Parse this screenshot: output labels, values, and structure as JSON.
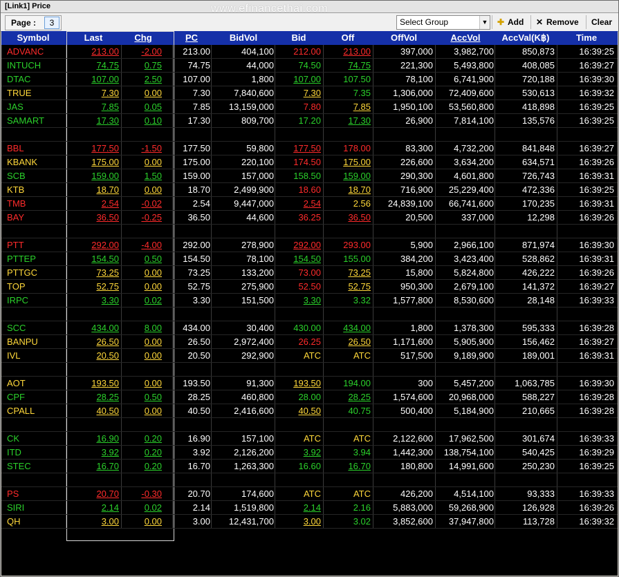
{
  "window": {
    "title": "[Link1] Price",
    "watermark": "www.efinancethai.com"
  },
  "toolbar": {
    "page_label": "Page :",
    "page_value": "3",
    "select_group": {
      "selected": "Select Group"
    },
    "add_label": "Add",
    "remove_label": "Remove",
    "clear_label": "Clear"
  },
  "colors": {
    "up": "#2bd12b",
    "down": "#ff2b2b",
    "unchanged": "#ffd83a",
    "header_bg": "#1530a8",
    "grid_bg": "#000000"
  },
  "columns": [
    "Symbol",
    "Last",
    "Chg",
    "PC",
    "BidVol",
    "Bid",
    "Off",
    "OffVol",
    "AccVol",
    "AccVal(K฿)",
    "Time"
  ],
  "rows": [
    {
      "symbol": "ADVANC",
      "last": "213.00",
      "chg": "-2.00",
      "pc": "213.00",
      "bidvol": "404,100",
      "bid": "212.00",
      "off": "213.00",
      "offvol": "397,000",
      "accvol": "3,982,700",
      "accval": "850,873",
      "time": "16:39:25",
      "c": {
        "sym": "down",
        "last": "down",
        "chg": "down",
        "bid": "down",
        "off": "down"
      }
    },
    {
      "symbol": "INTUCH",
      "last": "74.75",
      "chg": "0.75",
      "pc": "74.75",
      "bidvol": "44,000",
      "bid": "74.50",
      "off": "74.75",
      "offvol": "221,300",
      "accvol": "5,493,800",
      "accval": "408,085",
      "time": "16:39:27",
      "c": {
        "sym": "up",
        "last": "up",
        "chg": "up",
        "bid": "up",
        "off": "up"
      }
    },
    {
      "symbol": "DTAC",
      "last": "107.00",
      "chg": "2.50",
      "pc": "107.00",
      "bidvol": "1,800",
      "bid": "107.00",
      "off": "107.50",
      "offvol": "78,100",
      "accvol": "6,741,900",
      "accval": "720,188",
      "time": "16:39:30",
      "c": {
        "sym": "up",
        "last": "up",
        "chg": "up",
        "bid": "up",
        "off": "up"
      }
    },
    {
      "symbol": "TRUE",
      "last": "7.30",
      "chg": "0.00",
      "pc": "7.30",
      "bidvol": "7,840,600",
      "bid": "7.30",
      "off": "7.35",
      "offvol": "1,306,000",
      "accvol": "72,409,600",
      "accval": "530,613",
      "time": "16:39:32",
      "c": {
        "sym": "unchanged",
        "last": "unchanged",
        "chg": "unchanged",
        "bid": "unchanged",
        "off": "up"
      }
    },
    {
      "symbol": "JAS",
      "last": "7.85",
      "chg": "0.05",
      "pc": "7.85",
      "bidvol": "13,159,000",
      "bid": "7.80",
      "off": "7.85",
      "offvol": "1,950,100",
      "accvol": "53,560,800",
      "accval": "418,898",
      "time": "16:39:25",
      "c": {
        "sym": "up",
        "last": "up",
        "chg": "up",
        "bid": "down",
        "off": "unchanged"
      }
    },
    {
      "symbol": "SAMART",
      "last": "17.30",
      "chg": "0.10",
      "pc": "17.30",
      "bidvol": "809,700",
      "bid": "17.20",
      "off": "17.30",
      "offvol": "26,900",
      "accvol": "7,814,100",
      "accval": "135,576",
      "time": "16:39:25",
      "c": {
        "sym": "up",
        "last": "up",
        "chg": "up",
        "bid": "up",
        "off": "up"
      }
    },
    {
      "blank": true
    },
    {
      "symbol": "BBL",
      "last": "177.50",
      "chg": "-1.50",
      "pc": "177.50",
      "bidvol": "59,800",
      "bid": "177.50",
      "off": "178.00",
      "offvol": "83,300",
      "accvol": "4,732,200",
      "accval": "841,848",
      "time": "16:39:27",
      "c": {
        "sym": "down",
        "last": "down",
        "chg": "down",
        "bid": "down",
        "off": "down"
      }
    },
    {
      "symbol": "KBANK",
      "last": "175.00",
      "chg": "0.00",
      "pc": "175.00",
      "bidvol": "220,100",
      "bid": "174.50",
      "off": "175.00",
      "offvol": "226,600",
      "accvol": "3,634,200",
      "accval": "634,571",
      "time": "16:39:26",
      "c": {
        "sym": "unchanged",
        "last": "unchanged",
        "chg": "unchanged",
        "bid": "down",
        "off": "unchanged"
      }
    },
    {
      "symbol": "SCB",
      "last": "159.00",
      "chg": "1.50",
      "pc": "159.00",
      "bidvol": "157,000",
      "bid": "158.50",
      "off": "159.00",
      "offvol": "290,300",
      "accvol": "4,601,800",
      "accval": "726,743",
      "time": "16:39:31",
      "c": {
        "sym": "up",
        "last": "up",
        "chg": "up",
        "bid": "up",
        "off": "up"
      }
    },
    {
      "symbol": "KTB",
      "last": "18.70",
      "chg": "0.00",
      "pc": "18.70",
      "bidvol": "2,499,900",
      "bid": "18.60",
      "off": "18.70",
      "offvol": "716,900",
      "accvol": "25,229,400",
      "accval": "472,336",
      "time": "16:39:25",
      "c": {
        "sym": "unchanged",
        "last": "unchanged",
        "chg": "unchanged",
        "bid": "down",
        "off": "unchanged"
      }
    },
    {
      "symbol": "TMB",
      "last": "2.54",
      "chg": "-0.02",
      "pc": "2.54",
      "bidvol": "9,447,000",
      "bid": "2.54",
      "off": "2.56",
      "offvol": "24,839,100",
      "accvol": "66,741,600",
      "accval": "170,235",
      "time": "16:39:31",
      "c": {
        "sym": "down",
        "last": "down",
        "chg": "down",
        "bid": "down",
        "off": "unchanged"
      }
    },
    {
      "symbol": "BAY",
      "last": "36.50",
      "chg": "-0.25",
      "pc": "36.50",
      "bidvol": "44,600",
      "bid": "36.25",
      "off": "36.50",
      "offvol": "20,500",
      "accvol": "337,000",
      "accval": "12,298",
      "time": "16:39:26",
      "c": {
        "sym": "down",
        "last": "down",
        "chg": "down",
        "bid": "down",
        "off": "down"
      }
    },
    {
      "blank": true
    },
    {
      "symbol": "PTT",
      "last": "292.00",
      "chg": "-4.00",
      "pc": "292.00",
      "bidvol": "278,900",
      "bid": "292.00",
      "off": "293.00",
      "offvol": "5,900",
      "accvol": "2,966,100",
      "accval": "871,974",
      "time": "16:39:30",
      "c": {
        "sym": "down",
        "last": "down",
        "chg": "down",
        "bid": "down",
        "off": "down"
      }
    },
    {
      "symbol": "PTTEP",
      "last": "154.50",
      "chg": "0.50",
      "pc": "154.50",
      "bidvol": "78,100",
      "bid": "154.50",
      "off": "155.00",
      "offvol": "384,200",
      "accvol": "3,423,400",
      "accval": "528,862",
      "time": "16:39:31",
      "c": {
        "sym": "up",
        "last": "up",
        "chg": "up",
        "bid": "up",
        "off": "up"
      }
    },
    {
      "symbol": "PTTGC",
      "last": "73.25",
      "chg": "0.00",
      "pc": "73.25",
      "bidvol": "133,200",
      "bid": "73.00",
      "off": "73.25",
      "offvol": "15,800",
      "accvol": "5,824,800",
      "accval": "426,222",
      "time": "16:39:26",
      "c": {
        "sym": "unchanged",
        "last": "unchanged",
        "chg": "unchanged",
        "bid": "down",
        "off": "unchanged"
      }
    },
    {
      "symbol": "TOP",
      "last": "52.75",
      "chg": "0.00",
      "pc": "52.75",
      "bidvol": "275,900",
      "bid": "52.50",
      "off": "52.75",
      "offvol": "950,300",
      "accvol": "2,679,100",
      "accval": "141,372",
      "time": "16:39:27",
      "c": {
        "sym": "unchanged",
        "last": "unchanged",
        "chg": "unchanged",
        "bid": "down",
        "off": "unchanged"
      }
    },
    {
      "symbol": "IRPC",
      "last": "3.30",
      "chg": "0.02",
      "pc": "3.30",
      "bidvol": "151,500",
      "bid": "3.30",
      "off": "3.32",
      "offvol": "1,577,800",
      "accvol": "8,530,600",
      "accval": "28,148",
      "time": "16:39:33",
      "c": {
        "sym": "up",
        "last": "up",
        "chg": "up",
        "bid": "up",
        "off": "up"
      }
    },
    {
      "blank": true
    },
    {
      "symbol": "SCC",
      "last": "434.00",
      "chg": "8.00",
      "pc": "434.00",
      "bidvol": "30,400",
      "bid": "430.00",
      "off": "434.00",
      "offvol": "1,800",
      "accvol": "1,378,300",
      "accval": "595,333",
      "time": "16:39:28",
      "c": {
        "sym": "up",
        "last": "up",
        "chg": "up",
        "bid": "up",
        "off": "up"
      }
    },
    {
      "symbol": "BANPU",
      "last": "26.50",
      "chg": "0.00",
      "pc": "26.50",
      "bidvol": "2,972,400",
      "bid": "26.25",
      "off": "26.50",
      "offvol": "1,171,600",
      "accvol": "5,905,900",
      "accval": "156,462",
      "time": "16:39:27",
      "c": {
        "sym": "unchanged",
        "last": "unchanged",
        "chg": "unchanged",
        "bid": "down",
        "off": "unchanged"
      }
    },
    {
      "symbol": "IVL",
      "last": "20.50",
      "chg": "0.00",
      "pc": "20.50",
      "bidvol": "292,900",
      "bid": "ATC",
      "off": "ATC",
      "offvol": "517,500",
      "accvol": "9,189,900",
      "accval": "189,001",
      "time": "16:39:31",
      "c": {
        "sym": "unchanged",
        "last": "unchanged",
        "chg": "unchanged",
        "bid": "unchanged",
        "off": "unchanged"
      }
    },
    {
      "blank": true
    },
    {
      "symbol": "AOT",
      "last": "193.50",
      "chg": "0.00",
      "pc": "193.50",
      "bidvol": "91,300",
      "bid": "193.50",
      "off": "194.00",
      "offvol": "300",
      "accvol": "5,457,200",
      "accval": "1,063,785",
      "time": "16:39:30",
      "c": {
        "sym": "unchanged",
        "last": "unchanged",
        "chg": "unchanged",
        "bid": "unchanged",
        "off": "up"
      }
    },
    {
      "symbol": "CPF",
      "last": "28.25",
      "chg": "0.50",
      "pc": "28.25",
      "bidvol": "460,800",
      "bid": "28.00",
      "off": "28.25",
      "offvol": "1,574,600",
      "accvol": "20,968,000",
      "accval": "588,227",
      "time": "16:39:28",
      "c": {
        "sym": "up",
        "last": "up",
        "chg": "up",
        "bid": "up",
        "off": "up"
      }
    },
    {
      "symbol": "CPALL",
      "last": "40.50",
      "chg": "0.00",
      "pc": "40.50",
      "bidvol": "2,416,600",
      "bid": "40.50",
      "off": "40.75",
      "offvol": "500,400",
      "accvol": "5,184,900",
      "accval": "210,665",
      "time": "16:39:28",
      "c": {
        "sym": "unchanged",
        "last": "unchanged",
        "chg": "unchanged",
        "bid": "unchanged",
        "off": "up"
      }
    },
    {
      "blank": true
    },
    {
      "symbol": "CK",
      "last": "16.90",
      "chg": "0.20",
      "pc": "16.90",
      "bidvol": "157,100",
      "bid": "ATC",
      "off": "ATC",
      "offvol": "2,122,600",
      "accvol": "17,962,500",
      "accval": "301,674",
      "time": "16:39:33",
      "c": {
        "sym": "up",
        "last": "up",
        "chg": "up",
        "bid": "unchanged",
        "off": "unchanged"
      }
    },
    {
      "symbol": "ITD",
      "last": "3.92",
      "chg": "0.20",
      "pc": "3.92",
      "bidvol": "2,126,200",
      "bid": "3.92",
      "off": "3.94",
      "offvol": "1,442,300",
      "accvol": "138,754,100",
      "accval": "540,425",
      "time": "16:39:29",
      "c": {
        "sym": "up",
        "last": "up",
        "chg": "up",
        "bid": "up",
        "off": "up"
      }
    },
    {
      "symbol": "STEC",
      "last": "16.70",
      "chg": "0.20",
      "pc": "16.70",
      "bidvol": "1,263,300",
      "bid": "16.60",
      "off": "16.70",
      "offvol": "180,800",
      "accvol": "14,991,600",
      "accval": "250,230",
      "time": "16:39:25",
      "c": {
        "sym": "up",
        "last": "up",
        "chg": "up",
        "bid": "up",
        "off": "up"
      }
    },
    {
      "blank": true
    },
    {
      "symbol": "PS",
      "last": "20.70",
      "chg": "-0.30",
      "pc": "20.70",
      "bidvol": "174,600",
      "bid": "ATC",
      "off": "ATC",
      "offvol": "426,200",
      "accvol": "4,514,100",
      "accval": "93,333",
      "time": "16:39:33",
      "c": {
        "sym": "down",
        "last": "down",
        "chg": "down",
        "bid": "unchanged",
        "off": "unchanged"
      }
    },
    {
      "symbol": "SIRI",
      "last": "2.14",
      "chg": "0.02",
      "pc": "2.14",
      "bidvol": "1,519,800",
      "bid": "2.14",
      "off": "2.16",
      "offvol": "5,883,000",
      "accvol": "59,268,900",
      "accval": "126,928",
      "time": "16:39:26",
      "c": {
        "sym": "up",
        "last": "up",
        "chg": "up",
        "bid": "up",
        "off": "up"
      }
    },
    {
      "symbol": "QH",
      "last": "3.00",
      "chg": "0.00",
      "pc": "3.00",
      "bidvol": "12,431,700",
      "bid": "3.00",
      "off": "3.02",
      "offvol": "3,852,600",
      "accvol": "37,947,800",
      "accval": "113,728",
      "time": "16:39:32",
      "c": {
        "sym": "unchanged",
        "last": "unchanged",
        "chg": "unchanged",
        "bid": "unchanged",
        "off": "up"
      }
    }
  ]
}
